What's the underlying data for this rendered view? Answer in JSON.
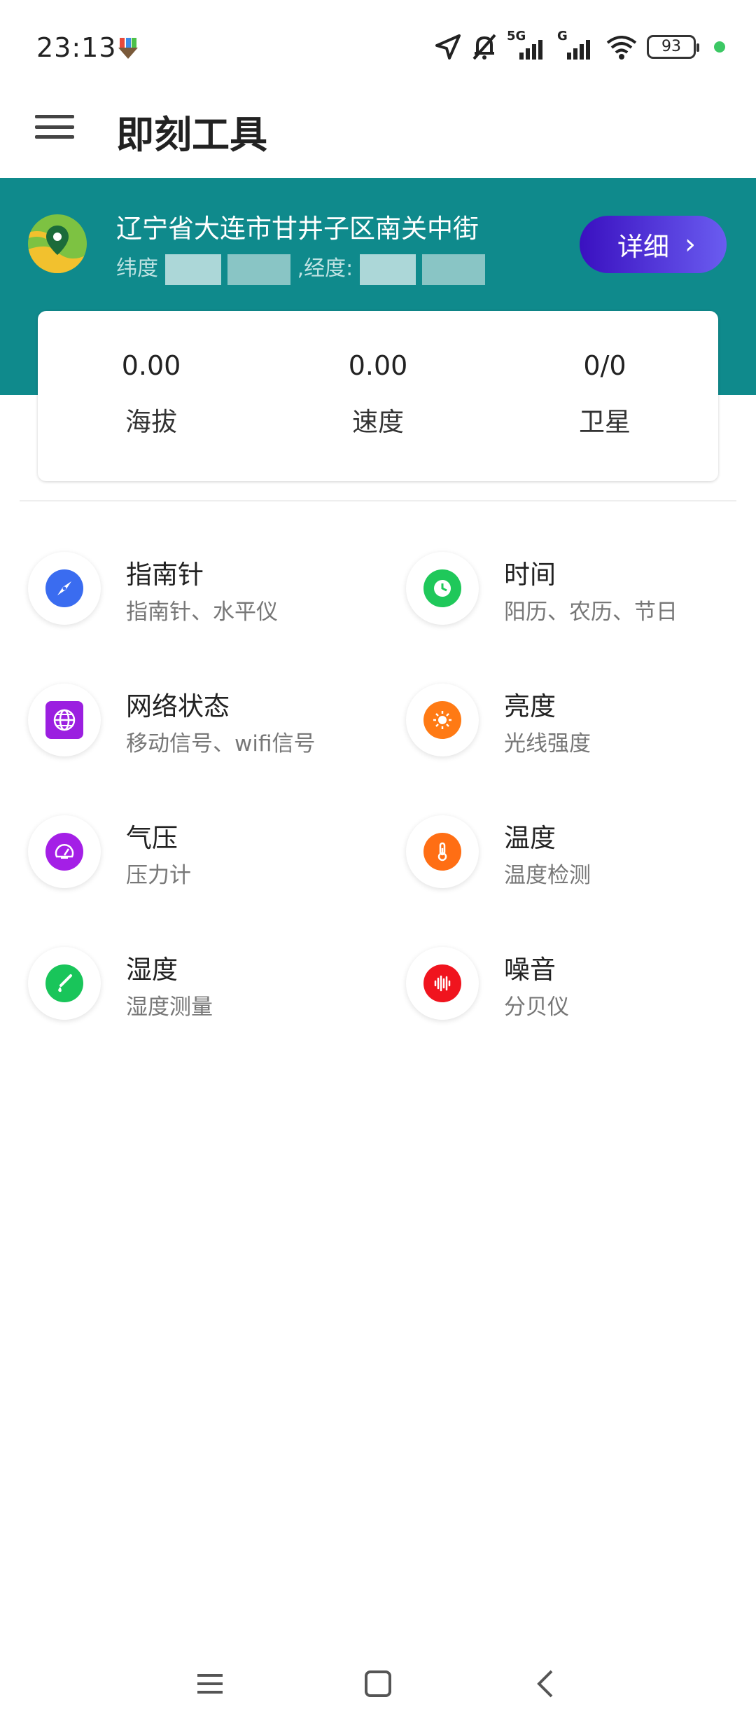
{
  "status_bar": {
    "time": "23:13",
    "network_5g": "5G",
    "network_g": "G",
    "battery": "93",
    "icons": [
      "app-download-icon",
      "location-arrow-icon",
      "bell-off-icon",
      "signal-5g-icon",
      "signal-g-icon",
      "wifi-icon",
      "battery-icon"
    ]
  },
  "app_bar": {
    "title": "即刻工具",
    "menu_icon": "hamburger-menu-icon"
  },
  "location": {
    "address": "辽宁省大连市甘井子区南关中街",
    "lat_label": "纬度",
    "lng_label": ",经度:",
    "detail_button": "详细",
    "detail_chevron": "›"
  },
  "stats": [
    {
      "value": "0.00",
      "label": "海拔"
    },
    {
      "value": "0.00",
      "label": "速度"
    },
    {
      "value": "0/0",
      "label": "卫星"
    }
  ],
  "tools": [
    {
      "title": "指南针",
      "subtitle": "指南针、水平仪",
      "icon": "compass-icon",
      "color": "#3a6cf0"
    },
    {
      "title": "时间",
      "subtitle": "阳历、农历、节日",
      "icon": "clock-icon",
      "color": "#1fc85a"
    },
    {
      "title": "网络状态",
      "subtitle": "移动信号、wifi信号",
      "icon": "globe-icon",
      "color": "#9b1fe0"
    },
    {
      "title": "亮度",
      "subtitle": "光线强度",
      "icon": "sun-icon",
      "color": "#ff7a14"
    },
    {
      "title": "气压",
      "subtitle": "压力计",
      "icon": "gauge-icon",
      "color": "#a41fe6"
    },
    {
      "title": "温度",
      "subtitle": "温度检测",
      "icon": "thermometer-icon",
      "color": "#ff6e14"
    },
    {
      "title": "湿度",
      "subtitle": "湿度测量",
      "icon": "humidity-icon",
      "color": "#19c55a"
    },
    {
      "title": "噪音",
      "subtitle": "分贝仪",
      "icon": "sound-wave-icon",
      "color": "#f0141e"
    }
  ],
  "nav_bar": {
    "icons": [
      "recent-apps-icon",
      "home-icon",
      "back-icon"
    ]
  }
}
